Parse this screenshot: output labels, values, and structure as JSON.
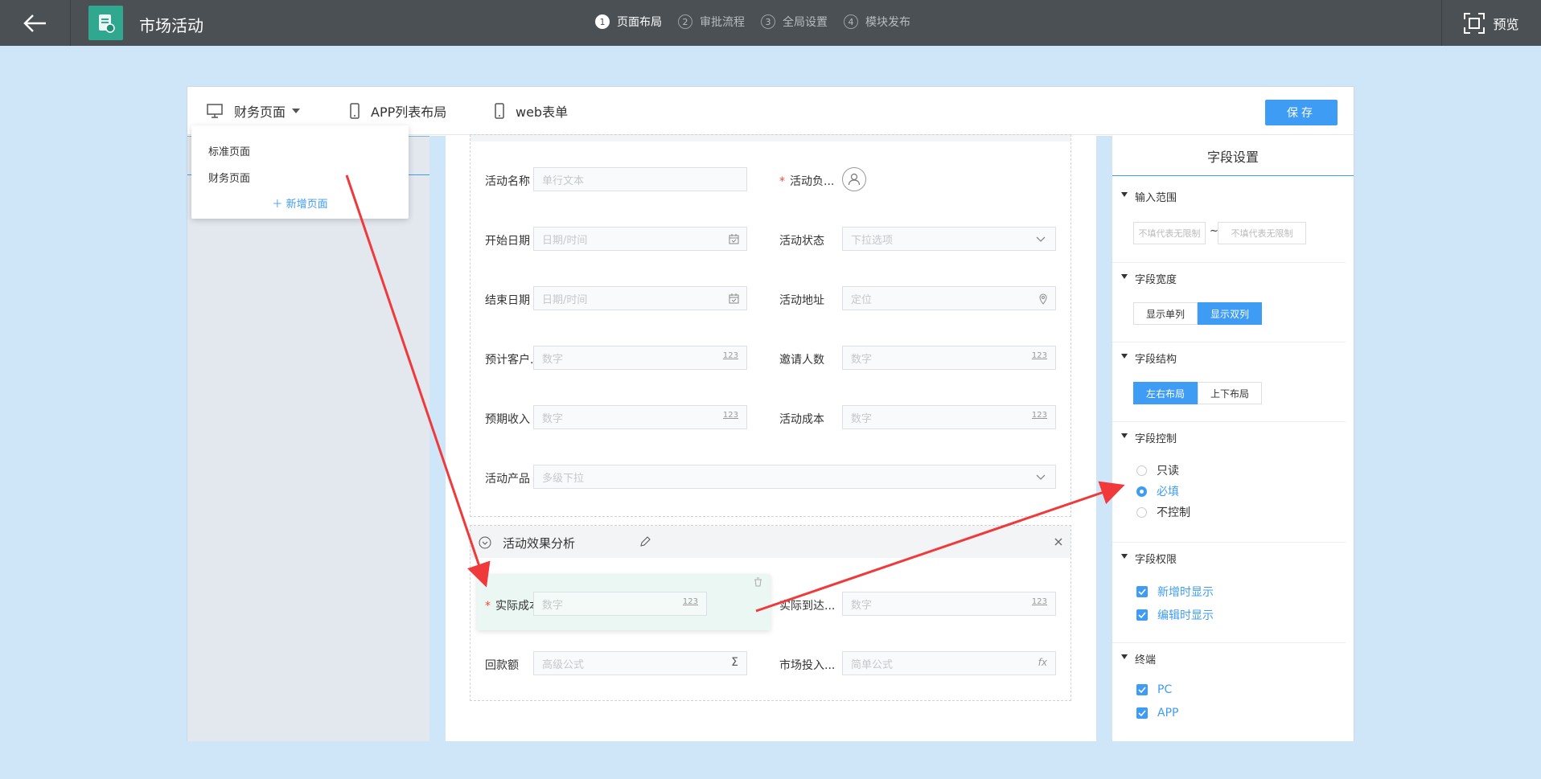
{
  "header": {
    "app_title": "市场活动",
    "steps": [
      {
        "num": "1",
        "label": "页面布局"
      },
      {
        "num": "2",
        "label": "审批流程"
      },
      {
        "num": "3",
        "label": "全局设置"
      },
      {
        "num": "4",
        "label": "模块发布"
      }
    ],
    "preview_label": "预览"
  },
  "tabs": {
    "finance_page": "财务页面",
    "app_list_layout": "APP列表布局",
    "web_form": "web表单",
    "save": "保存"
  },
  "dropdown": {
    "items": [
      "标准页面",
      "财务页面"
    ],
    "add_page": "新增页面"
  },
  "form": {
    "rows": [
      {
        "left_label": "活动名称",
        "left_placeholder": "单行文本",
        "right_label": "活动负...",
        "right_required": true
      },
      {
        "left_label": "开始日期",
        "left_placeholder": "日期/时间",
        "right_label": "活动状态",
        "right_placeholder": "下拉选项"
      },
      {
        "left_label": "结束日期",
        "left_placeholder": "日期/时间",
        "right_label": "活动地址",
        "right_placeholder": "定位"
      },
      {
        "left_label": "预计客户...",
        "left_placeholder": "数字",
        "left_suffix": "123",
        "right_label": "邀请人数",
        "right_placeholder": "数字",
        "right_suffix": "123"
      },
      {
        "left_label": "预期收入",
        "left_placeholder": "数字",
        "left_suffix": "123",
        "right_label": "活动成本",
        "right_placeholder": "数字",
        "right_suffix": "123"
      },
      {
        "left_label": "活动产品",
        "left_placeholder": "多级下拉"
      }
    ],
    "section2": {
      "title": "活动效果分析",
      "rows": [
        {
          "left_label": "实际成本",
          "left_required": true,
          "left_placeholder": "数字",
          "left_suffix": "123",
          "right_label": "实际到达...",
          "right_placeholder": "数字",
          "right_suffix": "123"
        },
        {
          "left_label": "回款额",
          "left_placeholder": "高级公式",
          "left_suffix": "Σ",
          "right_label": "市场投入...",
          "right_placeholder": "简单公式",
          "right_suffix": "fx"
        }
      ]
    }
  },
  "settings": {
    "title": "字段设置",
    "input_range": {
      "title": "输入范围",
      "min_placeholder": "不填代表无限制",
      "sep": "~",
      "max_placeholder": "不填代表无限制"
    },
    "field_width": {
      "title": "字段宽度",
      "options": [
        "显示单列",
        "显示双列"
      ],
      "selected": "显示双列"
    },
    "field_structure": {
      "title": "字段结构",
      "options": [
        "左右布局",
        "上下布局"
      ],
      "selected": "左右布局"
    },
    "field_control": {
      "title": "字段控制",
      "options": [
        "只读",
        "必填",
        "不控制"
      ],
      "selected": "必填"
    },
    "field_permission": {
      "title": "字段权限",
      "options": [
        "新增时显示",
        "编辑时显示"
      ]
    },
    "terminal": {
      "title": "终端",
      "options": [
        "PC",
        "APP"
      ]
    }
  },
  "colors": {
    "accent": "#3f9cf5",
    "topbar": "#4a5054",
    "background": "#cfe5f8",
    "logo": "#2fa88f",
    "arrow": "#f0393a"
  }
}
